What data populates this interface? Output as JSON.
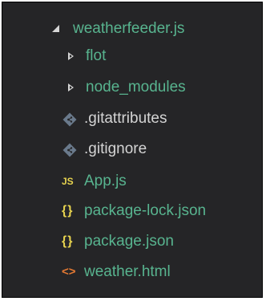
{
  "explorer": {
    "root": {
      "label": "weatherfeeder.js",
      "expanded": true,
      "icon": "chevron-down-icon"
    },
    "items": [
      {
        "label": "flot",
        "kind": "folder",
        "icon": "chevron-right-icon"
      },
      {
        "label": "node_modules",
        "kind": "folder",
        "icon": "chevron-right-icon"
      },
      {
        "label": ".gitattributes",
        "kind": "git",
        "icon": "git-diamond-icon"
      },
      {
        "label": ".gitignore",
        "kind": "git",
        "icon": "git-diamond-icon"
      },
      {
        "label": "App.js",
        "kind": "js",
        "icon": "js-icon",
        "icon_text": "JS"
      },
      {
        "label": "package-lock.json",
        "kind": "json",
        "icon": "json-braces-icon",
        "icon_text": "{}"
      },
      {
        "label": "package.json",
        "kind": "json",
        "icon": "json-braces-icon",
        "icon_text": "{}"
      },
      {
        "label": "weather.html",
        "kind": "html",
        "icon": "html-brackets-icon",
        "icon_text": "<>"
      }
    ]
  },
  "colors": {
    "background": "#252527",
    "folder_text": "#58b48f",
    "file_text": "#58b48f",
    "git_icon": "#6a7a8c",
    "js_icon": "#e7d34f",
    "json_icon": "#e7d34f",
    "html_icon": "#e37933"
  }
}
